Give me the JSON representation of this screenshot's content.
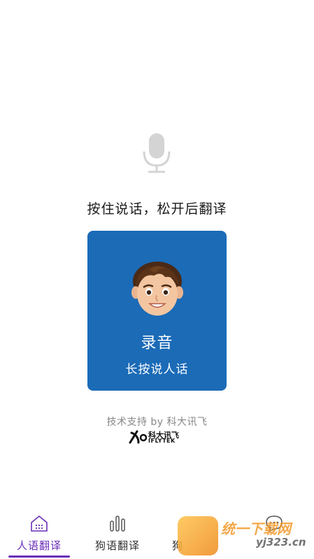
{
  "instruction": "按住说话，松开后翻译",
  "record_card": {
    "title": "录音",
    "subtitle": "长按说人话"
  },
  "credit": "技术支持 by 科大讯飞",
  "logo": {
    "brand_cn": "科大讯飞",
    "brand_en": "IFLYTEK"
  },
  "tabs": [
    {
      "label": "人语翻译",
      "icon": "house-dots-icon",
      "active": true
    },
    {
      "label": "狗语翻译",
      "icon": "sound-bars-icon",
      "active": false
    },
    {
      "label": "狗",
      "icon": "",
      "active": false
    },
    {
      "label": "",
      "icon": "chat-bubble-icon",
      "active": false
    }
  ],
  "watermark": {
    "site": "统一下载网",
    "domain": "yj323.cn"
  },
  "colors": {
    "card_blue": "#1b6bb7",
    "active_purple": "#6a2fb8"
  }
}
